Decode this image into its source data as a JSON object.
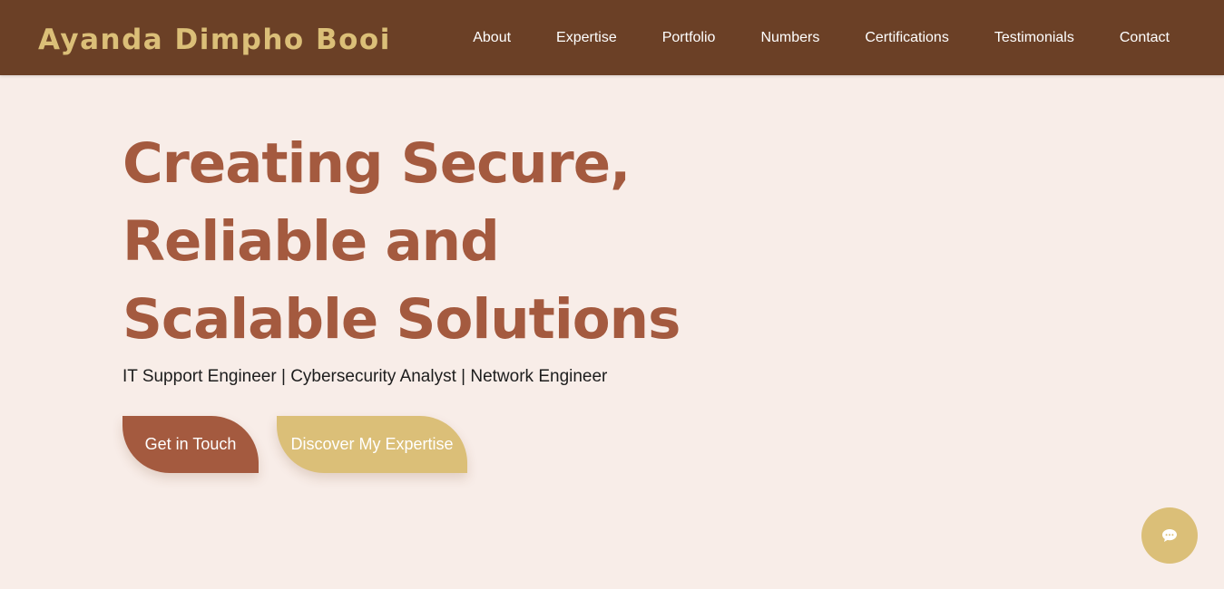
{
  "brand": {
    "name": "Ayanda Dimpho Booi"
  },
  "nav": {
    "items": [
      {
        "label": "About"
      },
      {
        "label": "Expertise"
      },
      {
        "label": "Portfolio"
      },
      {
        "label": "Numbers"
      },
      {
        "label": "Certifications"
      },
      {
        "label": "Testimonials"
      },
      {
        "label": "Contact"
      }
    ]
  },
  "hero": {
    "title_lines": [
      "Creating Secure,",
      "Reliable and",
      "Scalable Solutions"
    ],
    "subtitle": "IT Support Engineer | Cybersecurity Analyst | Network Engineer",
    "primary_button": "Get in Touch",
    "secondary_button": "Discover My Expertise"
  },
  "chat": {
    "icon": "chat-bubble-icon"
  },
  "colors": {
    "navbar": "#6b4026",
    "accent_gold": "#dbbf78",
    "accent_rust": "#a45a3f",
    "background": "#f8ede8"
  }
}
